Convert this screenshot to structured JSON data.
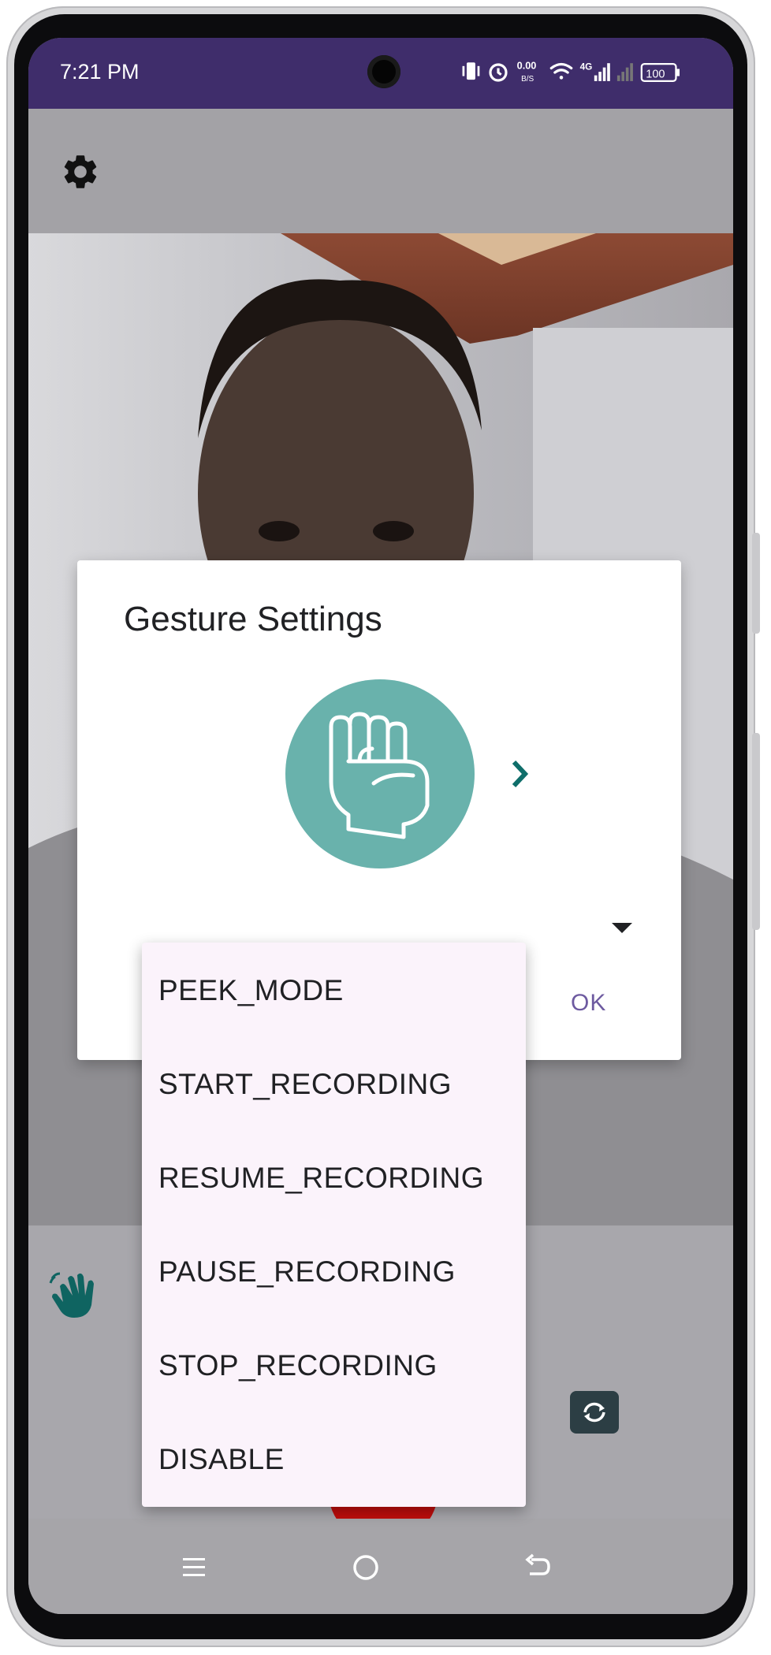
{
  "status_bar": {
    "time": "7:21 PM",
    "net_speed_value": "0.00",
    "net_speed_unit": "B/S",
    "network_type": "4G",
    "battery": "100"
  },
  "dialog": {
    "title": "Gesture Settings",
    "ok_label": "OK"
  },
  "gesture_menu": {
    "items": [
      {
        "label": "PEEK_MODE"
      },
      {
        "label": "START_RECORDING"
      },
      {
        "label": "RESUME_RECORDING"
      },
      {
        "label": "PAUSE_RECORDING"
      },
      {
        "label": "STOP_RECORDING"
      },
      {
        "label": "DISABLE"
      }
    ]
  },
  "icons": {
    "settings": "gear-icon",
    "gesture": "fist-icon",
    "next": "chevron-right-icon",
    "dropdown": "dropdown-arrow-icon",
    "wave": "wave-hand-icon",
    "flip": "flip-camera-icon",
    "record": "record-button",
    "nav_recents": "menu-icon",
    "nav_home": "home-icon",
    "nav_back": "back-icon"
  },
  "colors": {
    "status_bar": "#3f2d6b",
    "accent_teal": "#69b2ac",
    "chevron": "#0f6e6a",
    "ok_text": "#6d5aa0",
    "menu_bg": "#fbf3fb",
    "record_red": "#bf0d0c"
  }
}
